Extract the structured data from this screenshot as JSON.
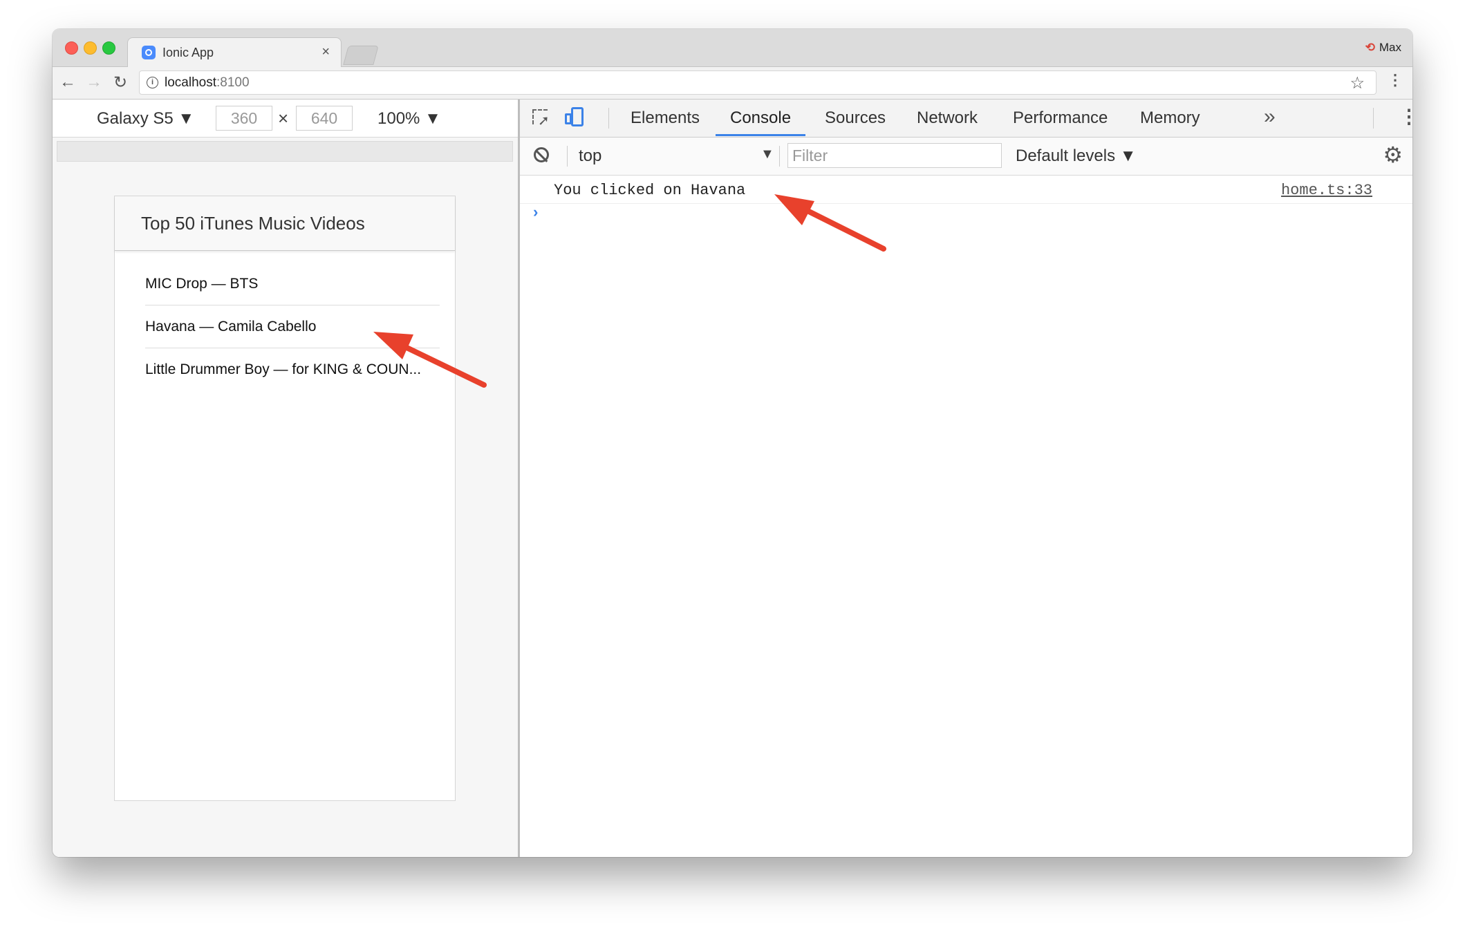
{
  "browser": {
    "tab_title": "Ionic App",
    "tab_close": "×",
    "profile_name": "Max",
    "url_host": "localhost",
    "url_port": ":8100"
  },
  "device_toolbar": {
    "device": "Galaxy S5",
    "width": "360",
    "height": "640",
    "times": "×",
    "zoom": "100%"
  },
  "app": {
    "title": "Top 50 iTunes Music Videos",
    "items": [
      "MIC Drop — BTS",
      "Havana — Camila Cabello",
      "Little Drummer Boy — for KING & COUN..."
    ]
  },
  "devtools": {
    "tabs": [
      "Elements",
      "Console",
      "Sources",
      "Network",
      "Performance",
      "Memory"
    ],
    "active_tab": "Console",
    "more_tabs": "»",
    "context": "top",
    "filter_placeholder": "Filter",
    "levels": "Default levels",
    "log": {
      "message": "You clicked on Havana",
      "source": "home.ts:33"
    },
    "prompt": "›"
  },
  "colors": {
    "accent": "#3b82e8",
    "annotation_arrow": "#e8412c"
  }
}
